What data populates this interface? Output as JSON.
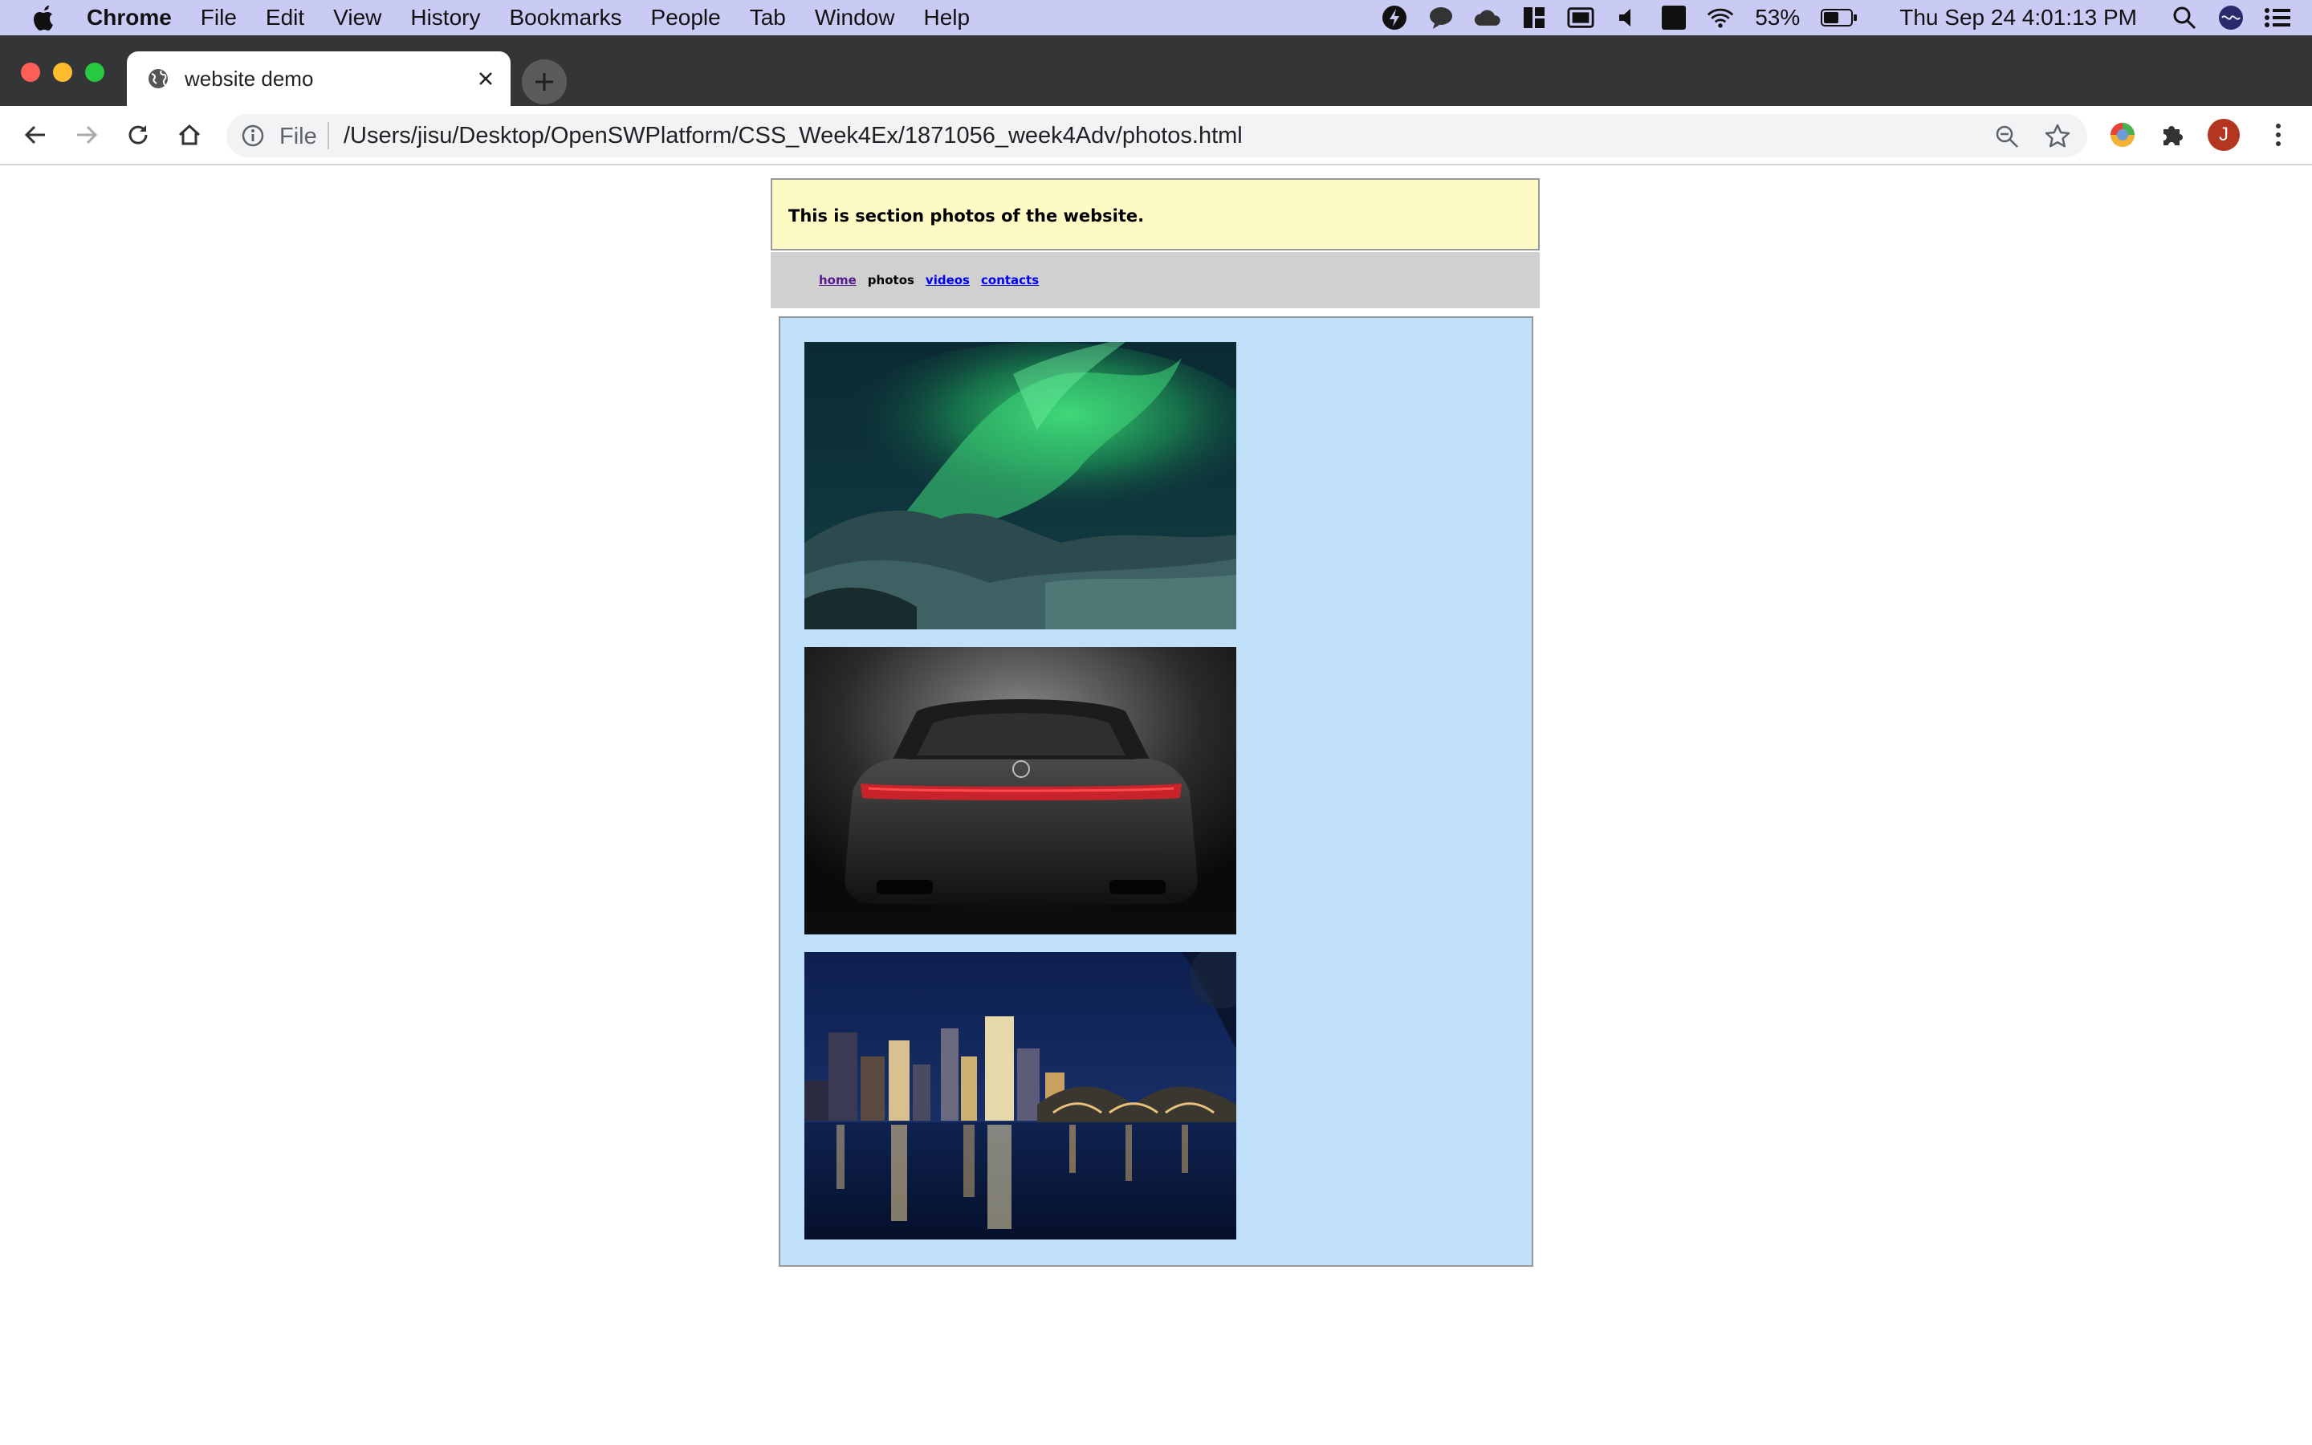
{
  "menubar": {
    "app_name": "Chrome",
    "items": [
      "File",
      "Edit",
      "View",
      "History",
      "Bookmarks",
      "People",
      "Tab",
      "Window",
      "Help"
    ],
    "battery": "53%",
    "datetime": "Thu Sep 24  4:01:13 PM",
    "input_source": "A"
  },
  "tab": {
    "title": "website demo"
  },
  "omnibox": {
    "scheme_label": "File",
    "url": "/Users/jisu/Desktop/OpenSWPlatform/CSS_Week4Ex/1871056_week4Adv/photos.html"
  },
  "profile": {
    "initial": "J",
    "color": "#b3361f"
  },
  "page": {
    "header_text": "This is section photos of the website.",
    "nav": {
      "home": "home",
      "photos": "photos",
      "videos": "videos",
      "contacts": "contacts"
    },
    "photos": [
      {
        "subject": "aurora-over-snowy-mountains"
      },
      {
        "subject": "rear-view-of-dark-sedan"
      },
      {
        "subject": "city-skyline-at-night-with-bridge"
      }
    ]
  },
  "colors": {
    "menubar_bg": "#c9cbf5",
    "tabstrip_bg": "#343536",
    "header_bg": "#fefac4",
    "nav_bg": "#d0d0d0",
    "gallery_bg": "#c0e0fa",
    "visited_link": "#551a8b",
    "link": "#0000ee"
  }
}
